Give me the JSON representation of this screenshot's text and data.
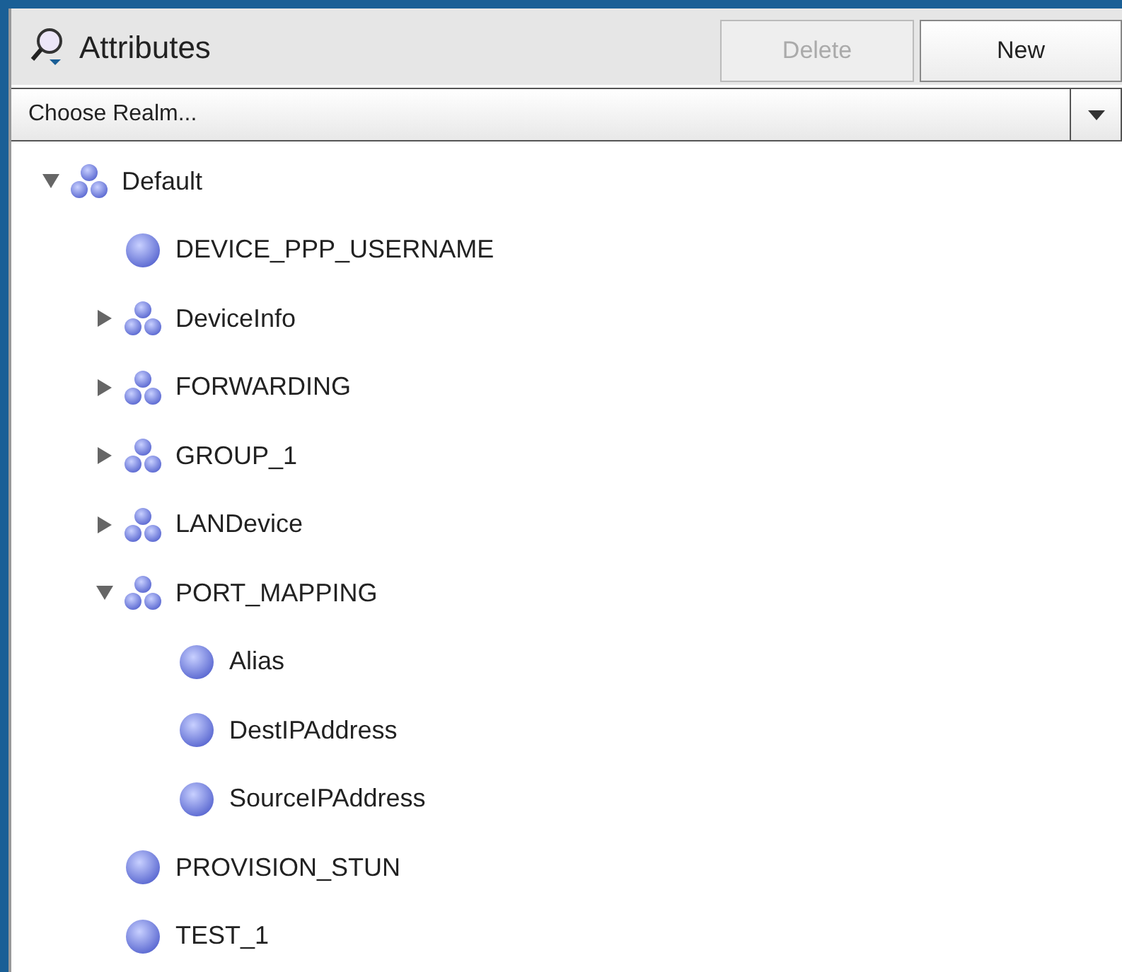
{
  "panel": {
    "title": "Attributes"
  },
  "buttons": [
    {
      "label": "Delete",
      "disabled": true
    },
    {
      "label": "New",
      "disabled": false
    }
  ],
  "realm_select": {
    "placeholder": "Choose Realm..."
  },
  "tree": [
    {
      "kind": "group",
      "label": "Default",
      "expanded": true,
      "children": [
        {
          "kind": "leaf",
          "label": "DEVICE_PPP_USERNAME"
        },
        {
          "kind": "group",
          "label": "DeviceInfo",
          "expanded": false
        },
        {
          "kind": "group",
          "label": "FORWARDING",
          "expanded": false
        },
        {
          "kind": "group",
          "label": "GROUP_1",
          "expanded": false
        },
        {
          "kind": "group",
          "label": "LANDevice",
          "expanded": false
        },
        {
          "kind": "group",
          "label": "PORT_MAPPING",
          "expanded": true,
          "children": [
            {
              "kind": "leaf",
              "label": "Alias"
            },
            {
              "kind": "leaf",
              "label": "DestIPAddress"
            },
            {
              "kind": "leaf",
              "label": "SourceIPAddress"
            }
          ]
        },
        {
          "kind": "leaf",
          "label": "PROVISION_STUN"
        },
        {
          "kind": "leaf",
          "label": "TEST_1"
        }
      ]
    }
  ]
}
